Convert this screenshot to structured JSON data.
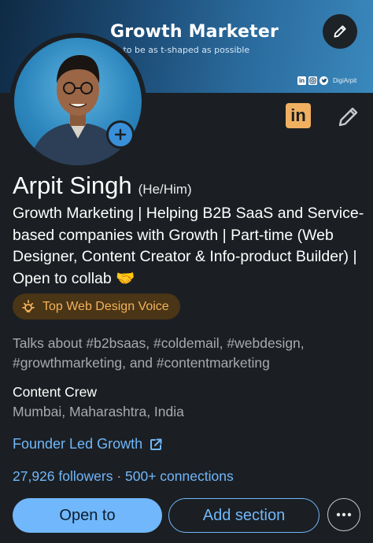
{
  "banner": {
    "title": "Growth Marketer",
    "subtitle": "g to be as t-shaped as possible",
    "social_handle": "DigiArpit",
    "social_icons": [
      "linkedin-icon",
      "instagram-icon",
      "twitter-icon"
    ]
  },
  "profile": {
    "name": "Arpit Singh",
    "pronouns": "(He/Him)",
    "headline": "Growth Marketing | Helping B2B SaaS and Service-based companies with Growth | Part-time (Web Designer, Content Creator & Info-product Builder) | Open to collab 🤝",
    "badge": "Top Web Design Voice",
    "talks_about": "Talks about #b2bsaas, #coldemail, #webdesign, #growthmarketing, and #contentmarketing",
    "company": "Content Crew",
    "location": "Mumbai, Maharashtra, India",
    "featured_link": "Founder Led Growth",
    "followers": "27,926 followers",
    "separator": " · ",
    "connections": "500+ connections"
  },
  "badges": {
    "linkedin_short": "in"
  },
  "actions": {
    "open_to": "Open to",
    "add_section": "Add section"
  },
  "colors": {
    "background": "#1b1f23",
    "accent": "#71b7fb",
    "badge_text": "#f3b25a",
    "muted_text": "#a7aaad"
  }
}
